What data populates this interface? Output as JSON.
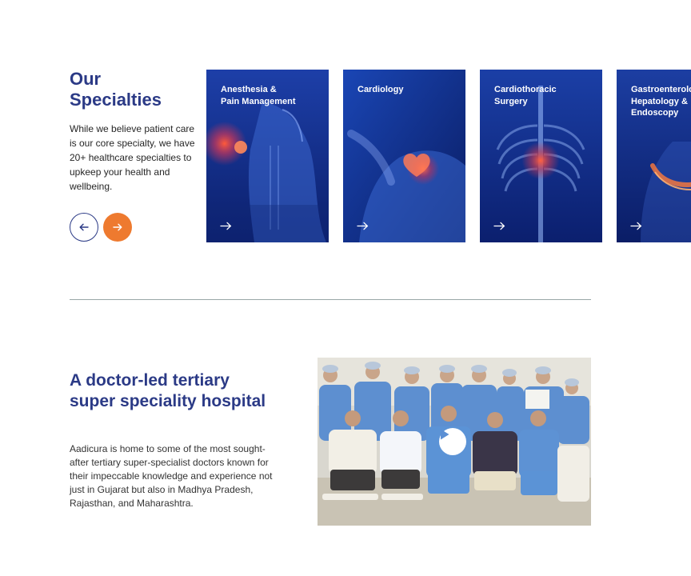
{
  "specialties": {
    "title": "Our Specialties",
    "description": "While we believe patient care is our core specialty, we have 20+ healthcare specialties to upkeep your health and wellbeing.",
    "cards": [
      {
        "title": "Anesthesia &\nPain Management"
      },
      {
        "title": "Cardiology"
      },
      {
        "title": "Cardiothoracic\nSurgery"
      },
      {
        "title": "Gastroenterology,\nHepatology &\nEndoscopy"
      }
    ],
    "nav": {
      "prev_icon": "arrow-left-icon",
      "next_icon": "arrow-right-icon"
    },
    "colors": {
      "primary": "#2b3a86",
      "accent": "#ee7a2f"
    }
  },
  "hospital": {
    "title": "A doctor-led tertiary super speciality hospital",
    "description": "Aadicura is home to some of the most sought-after tertiary super-specialist doctors known for their impeccable knowledge and experience not just in Gujarat but also in Madhya Pradesh, Rajasthan, and Maharashtra.",
    "video_icon": "play-icon"
  }
}
